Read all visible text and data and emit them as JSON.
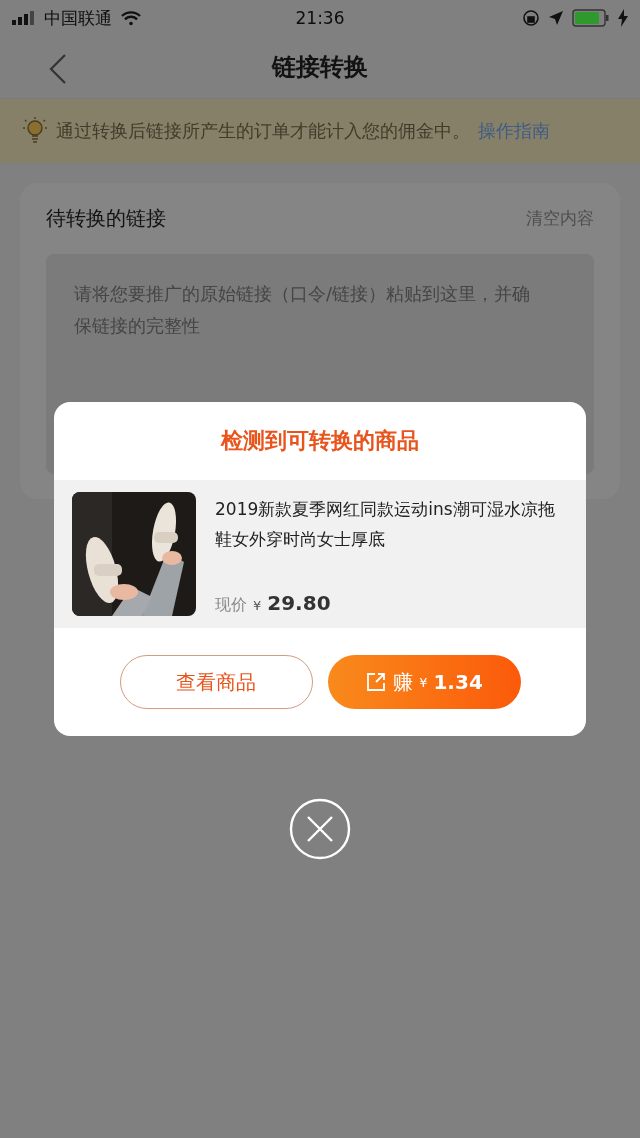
{
  "status_bar": {
    "carrier": "中国联通",
    "time": "21:36"
  },
  "nav": {
    "title": "链接转换"
  },
  "notice": {
    "text": "通过转换后链接所产生的订单才能计入您的佣金中。",
    "link": "操作指南"
  },
  "link_card": {
    "title": "待转换的链接",
    "clear": "清空内容",
    "placeholder": "请将您要推广的原始链接（口令/链接）粘贴到这里，并确保链接的完整性"
  },
  "dialog": {
    "title": "检测到可转换的商品",
    "product": {
      "name": "2019新款夏季网红同款运动ins潮可湿水凉拖鞋女外穿时尚女士厚底",
      "price_label": "现价",
      "currency": "¥",
      "price": "29.80"
    },
    "buttons": [
      {
        "kind": "outline",
        "label": "查看商品"
      },
      {
        "kind": "filled",
        "label": "赚",
        "currency": "¥",
        "amount": "1.34"
      }
    ]
  }
}
